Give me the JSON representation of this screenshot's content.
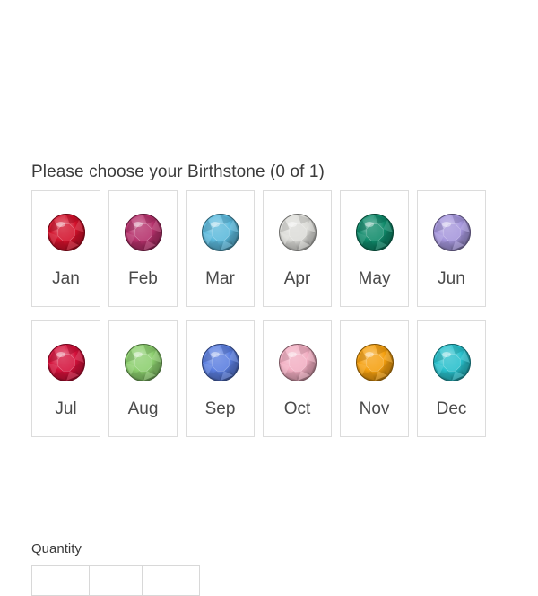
{
  "prompt": "Please choose your Birthstone (0 of 1)",
  "birthstones": [
    {
      "label": "Jan",
      "color": "#d2102a",
      "icon": "garnet-gem-icon"
    },
    {
      "label": "Feb",
      "color": "#b5306b",
      "icon": "amethyst-gem-icon"
    },
    {
      "label": "Mar",
      "color": "#5bb9dc",
      "icon": "aquamarine-gem-icon"
    },
    {
      "label": "Apr",
      "color": "#dcdcd8",
      "icon": "diamond-gem-icon"
    },
    {
      "label": "May",
      "color": "#0f8a6a",
      "icon": "emerald-gem-icon"
    },
    {
      "label": "Jun",
      "color": "#a596dc",
      "icon": "alexandrite-gem-icon"
    },
    {
      "label": "Jul",
      "color": "#d4103a",
      "icon": "ruby-gem-icon"
    },
    {
      "label": "Aug",
      "color": "#8ccf6e",
      "icon": "peridot-gem-icon"
    },
    {
      "label": "Sep",
      "color": "#5a7ee0",
      "icon": "sapphire-gem-icon"
    },
    {
      "label": "Oct",
      "color": "#f2aec2",
      "icon": "tourmaline-gem-icon"
    },
    {
      "label": "Nov",
      "color": "#f5a00f",
      "icon": "topaz-gem-icon"
    },
    {
      "label": "Dec",
      "color": "#28c0cc",
      "icon": "zircon-gem-icon"
    }
  ],
  "quantity": {
    "label": "Quantity"
  }
}
